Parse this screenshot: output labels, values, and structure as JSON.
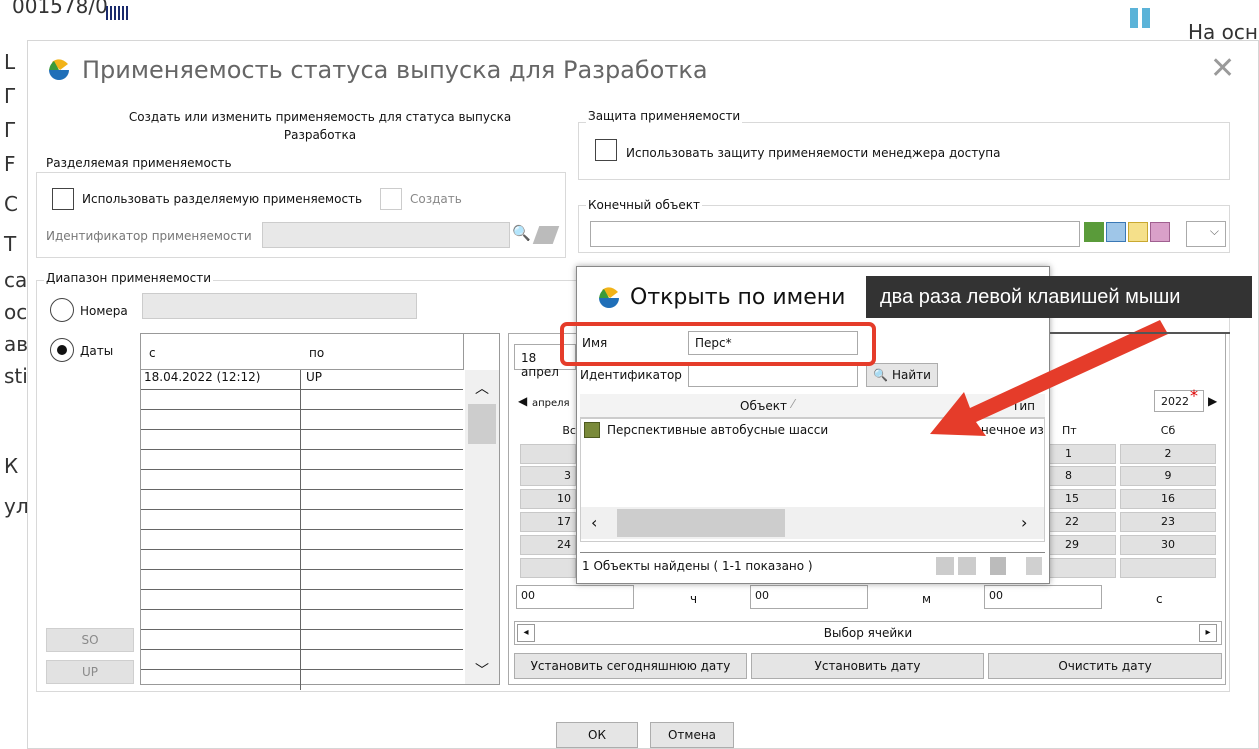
{
  "background": {
    "top_text": "001578/0",
    "right_text": "На осн",
    "left_fragments": [
      "L",
      "Г",
      "Г",
      "F",
      "С",
      "Т",
      "са",
      "ос",
      "ав",
      "sti",
      "К",
      "ул"
    ]
  },
  "dialog": {
    "title": "Применяемость статуса выпуска для Разработка",
    "description_line1": "Создать или изменить применяемость для статуса выпуска",
    "description_line2": "Разработка",
    "shared": {
      "legend": "Разделяемая применяемость",
      "use_shared_label": "Использовать разделяемую применяемость",
      "create_label": "Создать",
      "id_label": "Идентификатор применяемости"
    },
    "protection": {
      "legend": "Защита применяемости",
      "use_protection_label": "Использовать защиту применяемости менеджера доступа"
    },
    "end_item": {
      "legend": "Конечный объект"
    },
    "range": {
      "legend": "Диапазон применяемости",
      "numbers_label": "Номера",
      "dates_label": "Даты",
      "selected": "Даты",
      "col_from": "с",
      "col_to": "по",
      "rows": [
        {
          "from": "18.04.2022  (12:12)",
          "to": "UP"
        }
      ],
      "so_button": "SO",
      "up_button": "UP"
    },
    "calendar": {
      "date_field": "18 апрел",
      "month_nav": "апреля",
      "year": "2022",
      "required_mark": "*",
      "day_headers": {
        "sun": "Вс",
        "fri": "Пт",
        "sat": "Сб"
      },
      "left_col": [
        "",
        "3",
        "10",
        "17",
        "24",
        ""
      ],
      "fri_col": [
        "1",
        "8",
        "15",
        "22",
        "29",
        ""
      ],
      "sat_col": [
        "2",
        "9",
        "16",
        "23",
        "30",
        ""
      ],
      "hours": "00",
      "hours_unit": "ч",
      "minutes": "00",
      "minutes_unit": "м",
      "seconds": "00",
      "seconds_unit": "с",
      "cell_select_label": "Выбор ячейки",
      "set_today": "Установить сегодняшнюю дату",
      "set_date": "Установить дату",
      "clear_date": "Очистить дату"
    },
    "ok": "ОК",
    "cancel": "Отмена"
  },
  "popup": {
    "title": "Открыть по имени",
    "name_label": "Имя",
    "name_value": "Перс*",
    "id_label": "Идентификатор",
    "find_button": "Найти",
    "col_object": "Объект",
    "col_type": "Тип",
    "result_name": "Перспективные автобусные шасси",
    "result_type": "Конечное из",
    "status": "1 Объекты найдены ( 1-1  показано )"
  },
  "annotation": {
    "text": "два раза левой клавишей мыши"
  },
  "colors": {
    "annotation_red": "#e53c2a",
    "tooltip_bg": "#333333"
  }
}
